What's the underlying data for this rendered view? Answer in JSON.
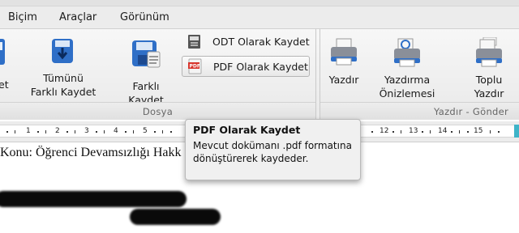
{
  "menubar": {
    "items": [
      "Biçim",
      "Araçlar",
      "Görünüm"
    ]
  },
  "ribbon": {
    "dosya_group": {
      "label": "Dosya",
      "buttons": [
        {
          "label_lines": [
            "et"
          ],
          "icon": "save-icon"
        },
        {
          "label_lines": [
            "Tümünü",
            "Farklı Kaydet"
          ],
          "icon": "save-all-icon"
        },
        {
          "label_lines": [
            "Farklı",
            "Kaydet"
          ],
          "icon": "save-as-icon"
        }
      ],
      "small_buttons": [
        {
          "label": "ODT Olarak Kaydet",
          "icon": "odt-document-icon"
        },
        {
          "label": "PDF Olarak Kaydet",
          "icon": "pdf-document-icon"
        }
      ]
    },
    "yazdir_group": {
      "label": "Yazdır - Gönder",
      "buttons": [
        {
          "label_lines": [
            "Yazdır"
          ],
          "icon": "printer-icon"
        },
        {
          "label_lines": [
            "Yazdırma",
            "Önizlemesi"
          ],
          "icon": "print-preview-icon"
        },
        {
          "label_lines": [
            "Toplu",
            "Yazdır"
          ],
          "icon": "batch-print-icon"
        }
      ]
    }
  },
  "ruler": {
    "numbers": [
      "1",
      "2",
      "3",
      "4",
      "5",
      "12",
      "13",
      "14",
      "15"
    ]
  },
  "document": {
    "first_line": "Konu: Öğrenci Devamsızlığı Hakk"
  },
  "tooltip": {
    "title": "PDF Olarak Kaydet",
    "body": "Mevcut dokümanı .pdf formatına dönüştürerek kaydeder."
  },
  "colors": {
    "accent_teal": "#3fb4c8",
    "pdf_red": "#d8342b",
    "save_blue": "#2f6fc7"
  }
}
